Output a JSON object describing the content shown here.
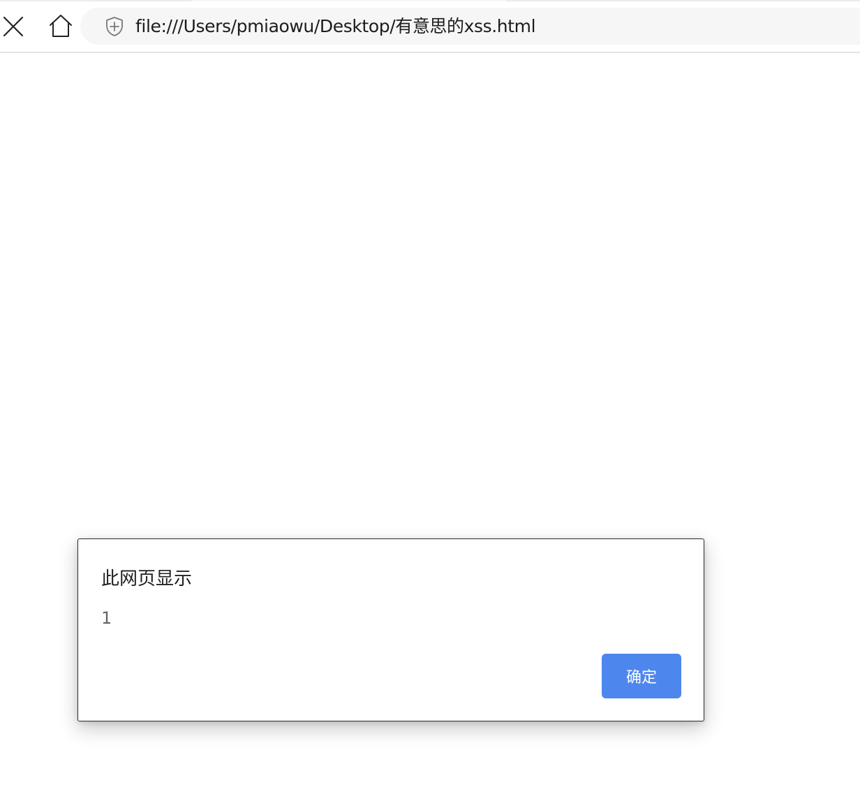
{
  "browser": {
    "url": "file:///Users/pmiaowu/Desktop/有意思的xss.html",
    "icons": {
      "stop": "close-icon",
      "home": "home-icon",
      "site_security": "shield-plus-icon"
    }
  },
  "alert_dialog": {
    "title": "此网页显示",
    "message": "1",
    "ok_label": "确定",
    "ok_color": "#4d87ee"
  }
}
